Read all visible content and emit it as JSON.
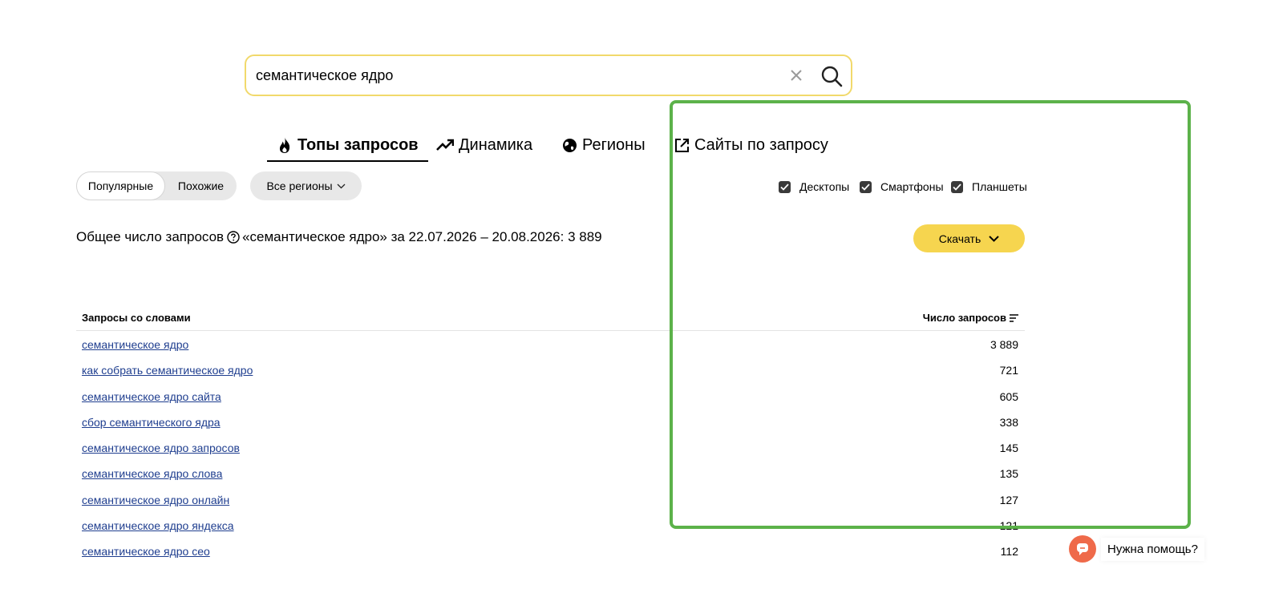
{
  "search": {
    "value": "семантическое ядро"
  },
  "tabs": [
    {
      "label": "Топы запросов",
      "icon": "flame-icon",
      "active": true
    },
    {
      "label": "Динамика",
      "icon": "trend-up-icon",
      "active": false
    },
    {
      "label": "Регионы",
      "icon": "globe-icon",
      "active": false
    },
    {
      "label": "Сайты по запросу",
      "icon": "external-link-icon",
      "active": false
    }
  ],
  "filters": {
    "mode_options": [
      "Популярные",
      "Похожие"
    ],
    "mode_selected": "Популярные",
    "region": "Все регионы",
    "devices": [
      {
        "label": "Десктопы",
        "checked": true
      },
      {
        "label": "Смартфоны",
        "checked": true
      },
      {
        "label": "Планшеты",
        "checked": true
      }
    ]
  },
  "summary": {
    "prefix": "Общее число запросов",
    "suffix": "«семантическое ядро» за 22.07.2026 – 20.08.2026: 3 889"
  },
  "download_label": "Скачать",
  "table": {
    "col_query": "Запросы со словами",
    "col_count": "Число запросов",
    "rows": [
      {
        "query": "семантическое ядро",
        "count": "3 889"
      },
      {
        "query": "как собрать семантическое ядро",
        "count": "721"
      },
      {
        "query": "семантическое ядро сайта",
        "count": "605"
      },
      {
        "query": "сбор семантического ядра",
        "count": "338"
      },
      {
        "query": "семантическое ядро запросов",
        "count": "145"
      },
      {
        "query": "семантическое ядро слова",
        "count": "135"
      },
      {
        "query": "семантическое ядро онлайн",
        "count": "127"
      },
      {
        "query": "семантическое ядро яндекса",
        "count": "121"
      },
      {
        "query": "семантическое ядро сео",
        "count": "112"
      }
    ]
  },
  "help_label": "Нужна помощь?",
  "colors": {
    "search_border": "#f1d96b",
    "download_bg": "#f6d54f",
    "link": "#1f3e8f",
    "highlight_frame": "#5cb24a",
    "help_bubble": "#ef6a4a"
  }
}
